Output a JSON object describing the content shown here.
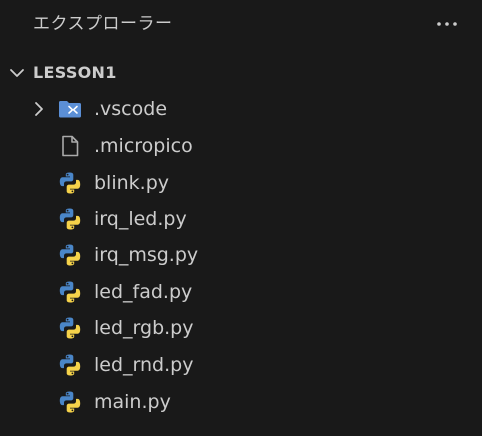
{
  "header": {
    "title": "エクスプローラー",
    "more_icon": "ellipsis-icon"
  },
  "folder": {
    "label": "LESSON1",
    "expanded": true,
    "chevron_icon": "chevron-down-icon"
  },
  "items": [
    {
      "label": ".vscode",
      "icon": "vscode-folder-icon",
      "kind": "folder",
      "expanded": false
    },
    {
      "label": ".micropico",
      "icon": "file-icon",
      "kind": "file"
    },
    {
      "label": "blink.py",
      "icon": "python-icon",
      "kind": "file"
    },
    {
      "label": "irq_led.py",
      "icon": "python-icon",
      "kind": "file"
    },
    {
      "label": "irq_msg.py",
      "icon": "python-icon",
      "kind": "file"
    },
    {
      "label": "led_fad.py",
      "icon": "python-icon",
      "kind": "file"
    },
    {
      "label": "led_rgb.py",
      "icon": "python-icon",
      "kind": "file"
    },
    {
      "label": "led_rnd.py",
      "icon": "python-icon",
      "kind": "file"
    },
    {
      "label": "main.py",
      "icon": "python-icon",
      "kind": "file"
    }
  ],
  "colors": {
    "background": "#191919",
    "text": "#cccccc",
    "python_blue": "#4a86c8",
    "python_yellow": "#f5d24a",
    "folder_blue": "#5b8fd6"
  }
}
